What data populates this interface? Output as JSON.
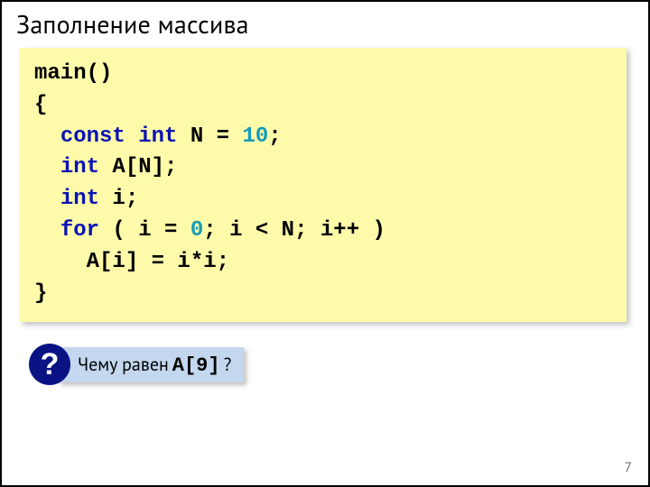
{
  "slide": {
    "title": "Заполнение массива",
    "page": "7"
  },
  "code": {
    "l1": "main()",
    "l2": "{",
    "l3_kw1": "const",
    "l3_kw2": "int",
    "l3_mid": " N = ",
    "l3_num": "10",
    "l3_end": ";",
    "l4_kw": "int",
    "l4_rest": " A[N];",
    "l5_kw": "int",
    "l5_rest": " i;",
    "l6_kw": "for",
    "l6_a": " ( i = ",
    "l6_n": "0",
    "l6_b": "; i < N; i++ ) ",
    "l7": "    A[i] = i*i;",
    "l8": "}"
  },
  "question": {
    "badge": "?",
    "prefix": "Чему равен ",
    "expr": "A[9]",
    "suffix": "?"
  }
}
